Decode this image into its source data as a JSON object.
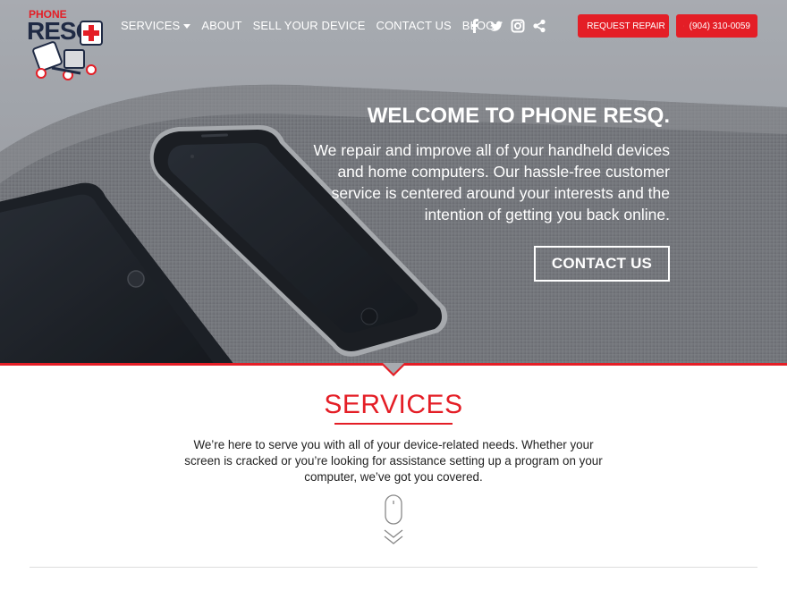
{
  "header": {
    "logo_top": "PHONE",
    "logo_main": "RESQ",
    "nav": [
      {
        "label": "SERVICES"
      },
      {
        "label": "ABOUT"
      },
      {
        "label": "SELL YOUR DEVICE"
      },
      {
        "label": "CONTACT US"
      },
      {
        "label": "BLOG"
      }
    ],
    "social_icons": [
      "facebook-icon",
      "twitter-icon",
      "instagram-icon",
      "share-icon"
    ],
    "request_repair_label": "REQUEST REPAIR",
    "phone_label": "(904) 310-0059"
  },
  "hero": {
    "title": "WELCOME TO PHONE RESQ.",
    "text": "We repair and improve all of your handheld devices and home computers. Our hassle-free customer service is centered around your interests and the intention of getting you back online.",
    "cta_label": "CONTACT US"
  },
  "services": {
    "title": "SERVICES",
    "text": "We’re here to serve you with all of your device-related needs. Whether your screen is cracked or you’re looking for assistance setting up a program on your computer, we’ve got you covered."
  },
  "colors": {
    "accent": "#e41e26",
    "text": "#222222"
  }
}
